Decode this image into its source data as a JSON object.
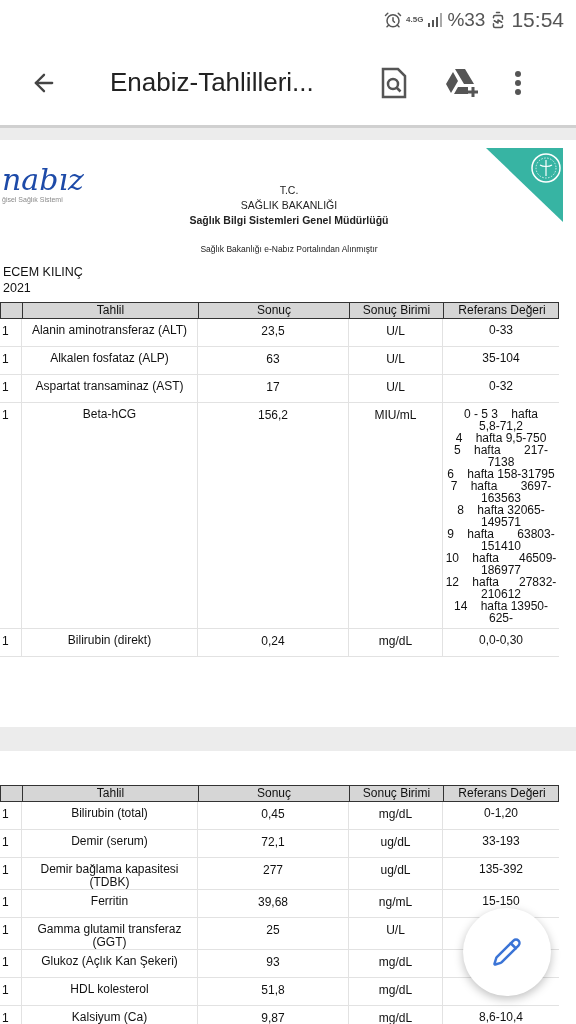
{
  "status_bar": {
    "network": "4.5G",
    "battery": "%33",
    "time": "15:54"
  },
  "app_bar": {
    "title": "Enabiz-Tahlilleri..."
  },
  "pages": [
    {
      "header": {
        "logo": "nabız",
        "logo_subtitle": "ğisel Sağlık Sistemi",
        "lines": [
          "T.C.",
          "SAĞLIK BAKANLIĞI",
          "Sağlık Bilgi Sistemleri Genel Müdürlüğü"
        ],
        "source": "Sağlık Bakanlığı e-Nabız Portalından Alınmıştır",
        "patient": "ECEM KILINÇ",
        "date": "2021"
      },
      "columns": [
        "Tahlil",
        "Sonuç",
        "Sonuç Birimi",
        "Referans Değeri"
      ],
      "rows": [
        {
          "column_1": "1",
          "test": "Alanin aminotransferaz (ALT)",
          "result": "23,5",
          "unit": "U/L",
          "reference": [
            "0-33"
          ]
        },
        {
          "column_1": "1",
          "test": "Alkalen fosfataz (ALP)",
          "result": "63",
          "unit": "U/L",
          "reference": [
            "35-104"
          ]
        },
        {
          "column_1": "1",
          "test": "Aspartat transaminaz (AST)",
          "result": "17",
          "unit": "U/L",
          "reference": [
            "0-32"
          ]
        },
        {
          "column_1": "1",
          "test": "Beta-hCG",
          "result": "156,2",
          "unit": "MIU/mL",
          "reference": [
            "0 - 5 3    hafta",
            "5,8-71,2",
            "4    hafta 9,5-750",
            "5    hafta       217-",
            "7138",
            "6    hafta 158-31795",
            "7    hafta       3697-",
            "163563",
            "8    hafta 32065-",
            "149571",
            "9    hafta       63803-",
            "151410",
            "10    hafta      46509-",
            "186977",
            "12    hafta      27832-",
            "210612",
            "14    hafta 13950-",
            "625-"
          ]
        },
        {
          "column_1": "1",
          "test": "Bilirubin (direkt)",
          "result": "0,24",
          "unit": "mg/dL",
          "reference": [
            "0,0-0,30"
          ]
        }
      ]
    },
    {
      "columns": [
        "Tahlil",
        "Sonuç",
        "Sonuç Birimi",
        "Referans Değeri"
      ],
      "rows": [
        {
          "column_1": "1",
          "test": "Bilirubin (total)",
          "result": "0,45",
          "unit": "mg/dL",
          "reference": [
            "0-1,20"
          ]
        },
        {
          "column_1": "1",
          "test": "Demir (serum)",
          "result": "72,1",
          "unit": "ug/dL",
          "reference": [
            "33-193"
          ]
        },
        {
          "column_1": "1",
          "test": "Demir bağlama kapasitesi (TDBK)",
          "result": "277",
          "unit": "ug/dL",
          "reference": [
            "135-392"
          ]
        },
        {
          "column_1": "1",
          "test": "Ferritin",
          "result": "39,68",
          "unit": "ng/mL",
          "reference": [
            "15-150"
          ]
        },
        {
          "column_1": "1",
          "test": "Gamma glutamil transferaz (GGT)",
          "result": "25",
          "unit": "U/L"
        },
        {
          "column_1": "1",
          "test": "Glukoz (Açlık Kan Şekeri)",
          "result": "93",
          "unit": "mg/dL"
        },
        {
          "column_1": "1",
          "test": "HDL kolesterol",
          "result": "51,8",
          "unit": "mg/dL"
        },
        {
          "column_1": "1",
          "test": "Kalsiyum (Ca)",
          "result": "9,87",
          "unit": "mg/dL",
          "reference": [
            "8,6-10,4"
          ]
        }
      ]
    }
  ]
}
